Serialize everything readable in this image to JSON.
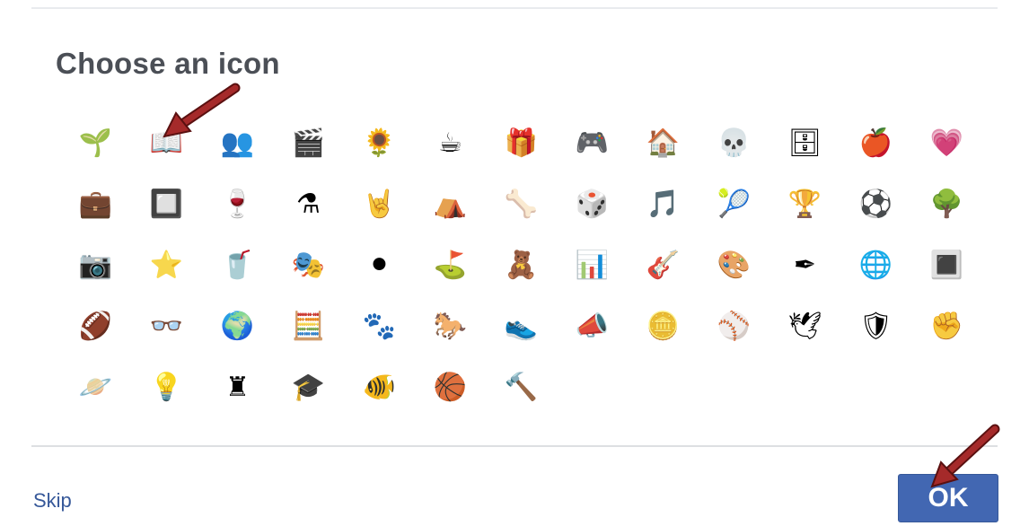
{
  "dialog": {
    "title": "Choose an icon",
    "skip_label": "Skip",
    "ok_label": "OK"
  },
  "icons": [
    {
      "name": "plant-icon",
      "glyph": "🌱"
    },
    {
      "name": "book-icon",
      "glyph": "📖"
    },
    {
      "name": "people-board-icon",
      "glyph": "👥"
    },
    {
      "name": "film-icon",
      "glyph": "🎬"
    },
    {
      "name": "sunflower-icon",
      "glyph": "🌻"
    },
    {
      "name": "mug-icon",
      "glyph": "☕"
    },
    {
      "name": "gift-icon",
      "glyph": "🎁"
    },
    {
      "name": "game-controller-icon",
      "glyph": "🎮"
    },
    {
      "name": "house-icon",
      "glyph": "🏠"
    },
    {
      "name": "skull-icon",
      "glyph": "💀"
    },
    {
      "name": "bookshelf-icon",
      "glyph": "🗄"
    },
    {
      "name": "apple-icon",
      "glyph": "🍎"
    },
    {
      "name": "heart-icon",
      "glyph": "💗"
    },
    {
      "name": "briefcase-icon",
      "glyph": "💼"
    },
    {
      "name": "chip-icon",
      "glyph": "🔲"
    },
    {
      "name": "wine-glass-icon",
      "glyph": "🍷"
    },
    {
      "name": "flask-icon",
      "glyph": "⚗"
    },
    {
      "name": "rock-hand-icon",
      "glyph": "🤘"
    },
    {
      "name": "tent-icon",
      "glyph": "⛺"
    },
    {
      "name": "bone-icon",
      "glyph": "🦴"
    },
    {
      "name": "dice-icon",
      "glyph": "🎲"
    },
    {
      "name": "music-note-icon",
      "glyph": "🎵"
    },
    {
      "name": "tennis-ball-icon",
      "glyph": "🎾"
    },
    {
      "name": "trophy-icon",
      "glyph": "🏆"
    },
    {
      "name": "soccer-ball-icon",
      "glyph": "⚽"
    },
    {
      "name": "tree-icon",
      "glyph": "🌳"
    },
    {
      "name": "camera-icon",
      "glyph": "📷"
    },
    {
      "name": "star-badge-icon",
      "glyph": "⭐"
    },
    {
      "name": "red-cup-icon",
      "glyph": "🥤"
    },
    {
      "name": "theater-masks-icon",
      "glyph": "🎭"
    },
    {
      "name": "hockey-puck-icon",
      "glyph": "⚫"
    },
    {
      "name": "golf-ball-icon",
      "glyph": "⛳"
    },
    {
      "name": "teddy-bear-icon",
      "glyph": "🧸"
    },
    {
      "name": "presentation-icon",
      "glyph": "📊"
    },
    {
      "name": "guitar-icon",
      "glyph": "🎸"
    },
    {
      "name": "palette-icon",
      "glyph": "🎨"
    },
    {
      "name": "quill-icon",
      "glyph": "✒"
    },
    {
      "name": "pie-chart-icon",
      "glyph": "🌐"
    },
    {
      "name": "frame-icon",
      "glyph": "🔳"
    },
    {
      "name": "football-icon",
      "glyph": "🏈"
    },
    {
      "name": "glasses-icon",
      "glyph": "👓"
    },
    {
      "name": "globe-icon",
      "glyph": "🌍"
    },
    {
      "name": "calculator-icon",
      "glyph": "🧮"
    },
    {
      "name": "paw-icon",
      "glyph": "🐾"
    },
    {
      "name": "horse-icon",
      "glyph": "🐎"
    },
    {
      "name": "sneaker-icon",
      "glyph": "👟"
    },
    {
      "name": "megaphone-icon",
      "glyph": "📣"
    },
    {
      "name": "coin-icon",
      "glyph": "🪙"
    },
    {
      "name": "baseball-icon",
      "glyph": "⚾"
    },
    {
      "name": "dove-icon",
      "glyph": "🕊"
    },
    {
      "name": "shield-icon",
      "glyph": "🛡"
    },
    {
      "name": "fist-icon",
      "glyph": "✊"
    },
    {
      "name": "planet-icon",
      "glyph": "🪐"
    },
    {
      "name": "lightbulb-icon",
      "glyph": "💡"
    },
    {
      "name": "chess-rook-icon",
      "glyph": "♜"
    },
    {
      "name": "graduation-cap-icon",
      "glyph": "🎓"
    },
    {
      "name": "fishbowl-icon",
      "glyph": "🐠"
    },
    {
      "name": "basketball-icon",
      "glyph": "🏀"
    },
    {
      "name": "gavel-icon",
      "glyph": "🔨"
    }
  ],
  "colors": {
    "title": "#4b4f56",
    "link": "#365899",
    "primary_button": "#4267b2",
    "annotation_arrow": "#8b1a1a"
  }
}
